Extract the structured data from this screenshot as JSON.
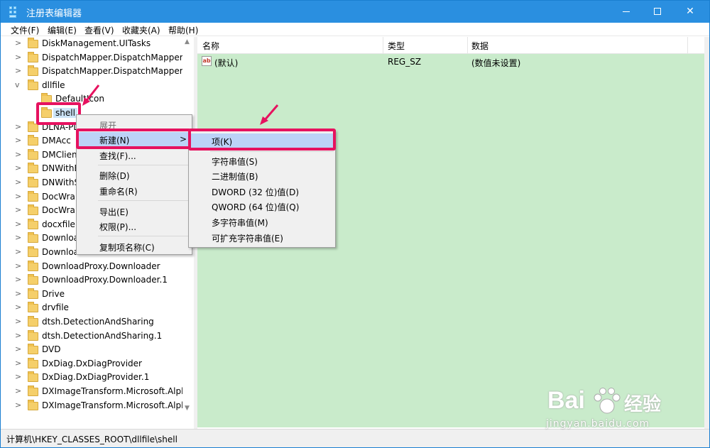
{
  "window": {
    "title": "注册表编辑器",
    "controls": {
      "minimize": "—",
      "maximize": "□",
      "close": "✕"
    }
  },
  "menubar": [
    "文件(F)",
    "编辑(E)",
    "查看(V)",
    "收藏夹(A)",
    "帮助(H)"
  ],
  "tree": {
    "items": [
      {
        "label": "DiskManagement.UITasks",
        "expander": ">"
      },
      {
        "label": "DispatchMapper.DispatchMapper",
        "expander": ">"
      },
      {
        "label": "DispatchMapper.DispatchMapper.",
        "expander": ">"
      },
      {
        "label": "dllfile",
        "expander": "v"
      },
      {
        "label": "DefaultIcon",
        "expander": ""
      },
      {
        "label": "shell",
        "expander": "",
        "selected": true
      },
      {
        "label": "DLNA-PL",
        "expander": ">"
      },
      {
        "label": "DMAcc",
        "expander": ">"
      },
      {
        "label": "DMClien",
        "expander": ">"
      },
      {
        "label": "DNWithB",
        "expander": ">"
      },
      {
        "label": "DNWithS",
        "expander": ">"
      },
      {
        "label": "DocWra",
        "expander": ">"
      },
      {
        "label": "DocWra",
        "expander": ">"
      },
      {
        "label": "docxfile",
        "expander": ">"
      },
      {
        "label": "Downloa",
        "expander": ">"
      },
      {
        "label": "Downloa",
        "expander": ">"
      },
      {
        "label": "DownloadProxy.Downloader",
        "expander": ">"
      },
      {
        "label": "DownloadProxy.Downloader.1",
        "expander": ">"
      },
      {
        "label": "Drive",
        "expander": ">"
      },
      {
        "label": "drvfile",
        "expander": ">"
      },
      {
        "label": "dtsh.DetectionAndSharing",
        "expander": ">"
      },
      {
        "label": "dtsh.DetectionAndSharing.1",
        "expander": ">"
      },
      {
        "label": "DVD",
        "expander": ">"
      },
      {
        "label": "DxDiag.DxDiagProvider",
        "expander": ">"
      },
      {
        "label": "DxDiag.DxDiagProvider.1",
        "expander": ">"
      },
      {
        "label": "DXImageTransform.Microsoft.Alph",
        "expander": ">"
      },
      {
        "label": "DXImageTransform.Microsoft.Alph",
        "expander": ">"
      }
    ]
  },
  "list": {
    "columns": [
      "名称",
      "类型",
      "数据"
    ],
    "rows": [
      {
        "icon": "ab",
        "name": "(默认)",
        "type": "REG_SZ",
        "data": "(数值未设置)"
      }
    ]
  },
  "context_menu": {
    "items": [
      "展开",
      "新建(N)",
      "查找(F)...",
      "删除(D)",
      "重命名(R)",
      "导出(E)",
      "权限(P)...",
      "复制项名称(C)"
    ],
    "submenu_arrow": ">"
  },
  "submenu": {
    "items": [
      "项(K)",
      "字符串值(S)",
      "二进制值(B)",
      "DWORD (32 位)值(D)",
      "QWORD (64 位)值(Q)",
      "多字符串值(M)",
      "可扩充字符串值(E)"
    ]
  },
  "statusbar": {
    "path": "计算机\\HKEY_CLASSES_ROOT\\dllfile\\shell"
  },
  "watermark": {
    "brand": "Bai",
    "brand2": "经验",
    "url": "jingyan.baidu.com"
  },
  "colors": {
    "accent": "#e6125f",
    "titlebar": "#2a8fe0",
    "listbg": "#c9ebcb",
    "highlight": "#bcd3f7"
  }
}
